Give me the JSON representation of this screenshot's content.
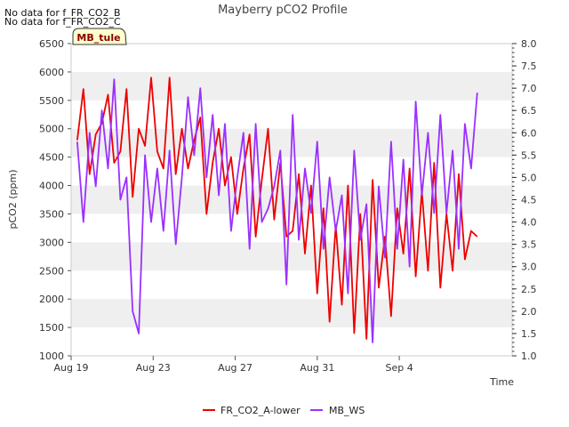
{
  "chart_data": {
    "type": "line",
    "title": "Mayberry pCO2 Profile",
    "xlabel": "Time",
    "ylabel": "pCO2 (ppm)",
    "ylim": [
      1000,
      6500
    ],
    "y2lim": [
      1.0,
      8.0
    ],
    "xlim": [
      0,
      21.5
    ],
    "x_tick_labels": [
      "Aug 19",
      "Aug 23",
      "Aug 27",
      "Aug 31",
      "Sep 4"
    ],
    "x_tick_days": [
      0,
      4,
      8,
      12,
      16
    ],
    "y_ticks": [
      1000,
      1500,
      2000,
      2500,
      3000,
      3500,
      4000,
      4500,
      5000,
      5500,
      6000,
      6500
    ],
    "y2_ticks": [
      "1.0",
      "1.5",
      "2.0",
      "2.5",
      "3.0",
      "3.5",
      "4.0",
      "4.5",
      "5.0",
      "5.5",
      "6.0",
      "6.5",
      "7.0",
      "7.5",
      "8.0"
    ],
    "grid": "horizontal bands",
    "legend_position": "bottom",
    "notes": [
      "No data for f_FR_CO2_B",
      "No data for f_FR_CO2_C"
    ],
    "site_badge": "MB_tule",
    "series": [
      {
        "name": "FR_CO2_A-lower",
        "axis": "left",
        "color": "#ee0000",
        "x": [
          0.3,
          0.6,
          0.9,
          1.2,
          1.5,
          1.8,
          2.1,
          2.4,
          2.7,
          3.0,
          3.3,
          3.6,
          3.9,
          4.2,
          4.5,
          4.8,
          5.1,
          5.4,
          5.7,
          6.0,
          6.3,
          6.6,
          6.9,
          7.2,
          7.5,
          7.8,
          8.1,
          8.4,
          8.7,
          9.0,
          9.3,
          9.6,
          9.9,
          10.2,
          10.5,
          10.8,
          11.1,
          11.4,
          11.7,
          12.0,
          12.3,
          12.6,
          12.9,
          13.2,
          13.5,
          13.8,
          14.1,
          14.4,
          14.7,
          15.0,
          15.3,
          15.6,
          15.9,
          16.2,
          16.5,
          16.8,
          17.1,
          17.4,
          17.7,
          18.0,
          18.3,
          18.6,
          18.9,
          19.2,
          19.5,
          19.8
        ],
        "values": [
          4800,
          5700,
          4200,
          4900,
          5100,
          5600,
          4400,
          4600,
          5700,
          3800,
          5000,
          4700,
          5900,
          4600,
          4300,
          5900,
          4200,
          5000,
          4300,
          4800,
          5200,
          3500,
          4400,
          5000,
          4000,
          4500,
          3500,
          4300,
          4900,
          3100,
          4100,
          5000,
          3400,
          4400,
          3100,
          3200,
          4200,
          2800,
          4000,
          2100,
          3600,
          1600,
          3300,
          1900,
          4000,
          1400,
          3500,
          1300,
          4100,
          2200,
          3100,
          1700,
          3600,
          2800,
          4300,
          2400,
          3900,
          2500,
          4400,
          2200,
          3500,
          2500,
          4200,
          2700,
          3200,
          3100
        ]
      },
      {
        "name": "MB_WS",
        "axis": "right",
        "color": "#9b30ff",
        "x": [
          0.3,
          0.6,
          0.9,
          1.2,
          1.5,
          1.8,
          2.1,
          2.4,
          2.7,
          3.0,
          3.3,
          3.6,
          3.9,
          4.2,
          4.5,
          4.8,
          5.1,
          5.4,
          5.7,
          6.0,
          6.3,
          6.6,
          6.9,
          7.2,
          7.5,
          7.8,
          8.1,
          8.4,
          8.7,
          9.0,
          9.3,
          9.6,
          9.9,
          10.2,
          10.5,
          10.8,
          11.1,
          11.4,
          11.7,
          12.0,
          12.3,
          12.6,
          12.9,
          13.2,
          13.5,
          13.8,
          14.1,
          14.4,
          14.7,
          15.0,
          15.3,
          15.6,
          15.9,
          16.2,
          16.5,
          16.8,
          17.1,
          17.4,
          17.7,
          18.0,
          18.3,
          18.6,
          18.9,
          19.2,
          19.5,
          19.8
        ],
        "values": [
          5.8,
          4.0,
          6.0,
          4.8,
          6.5,
          5.2,
          7.2,
          4.5,
          5.0,
          2.0,
          1.5,
          5.5,
          4.0,
          5.2,
          3.8,
          5.6,
          3.5,
          5.0,
          6.8,
          5.5,
          7.0,
          5.0,
          6.4,
          4.6,
          6.2,
          3.8,
          5.0,
          6.0,
          3.4,
          6.2,
          4.0,
          4.3,
          4.8,
          5.6,
          2.6,
          6.4,
          3.6,
          5.2,
          4.2,
          5.8,
          3.4,
          5.0,
          3.8,
          4.6,
          2.4,
          5.6,
          3.6,
          4.4,
          1.3,
          4.8,
          3.2,
          5.8,
          3.4,
          5.4,
          3.0,
          6.7,
          4.6,
          6.0,
          4.2,
          6.4,
          4.2,
          5.6,
          3.4,
          6.2,
          5.2,
          6.9
        ]
      }
    ]
  }
}
